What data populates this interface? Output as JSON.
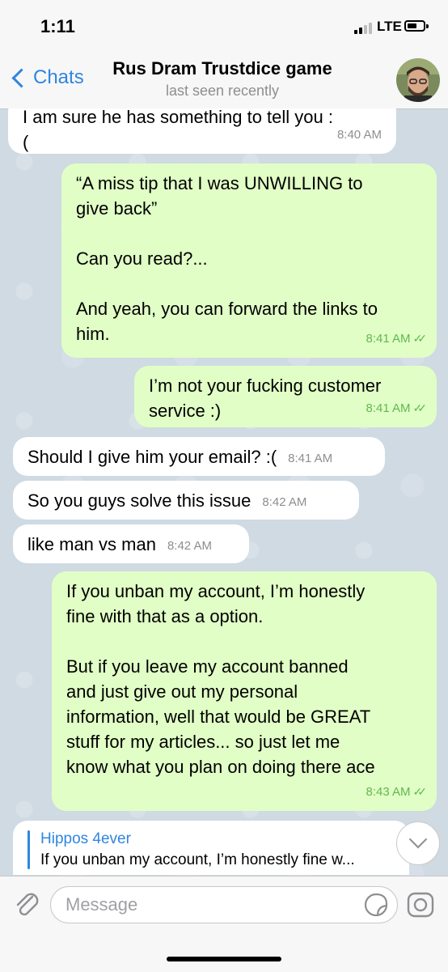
{
  "status_bar": {
    "time": "1:11",
    "network": "LTE"
  },
  "header": {
    "back_label": "Chats",
    "title": "Rus Dram Trustdice game",
    "subtitle": "last seen recently"
  },
  "messages": [
    {
      "direction": "in",
      "text": "I am sure he has something to tell you :\n(",
      "time": "8:40 AM"
    },
    {
      "direction": "out",
      "text": "“A miss tip that I was UNWILLING to\ngive back”\n\nCan you read?...\n\nAnd yeah, you can forward the links to\nhim.",
      "time": "8:41 AM"
    },
    {
      "direction": "out",
      "text": "I’m not your fucking customer\nservice :)",
      "time": "8:41 AM"
    },
    {
      "direction": "in",
      "text": "Should I give him your email? :(",
      "time": "8:41 AM"
    },
    {
      "direction": "in",
      "text": "So you guys solve this issue",
      "time": "8:42 AM"
    },
    {
      "direction": "in",
      "text": "like man vs man",
      "time": "8:42 AM"
    },
    {
      "direction": "out",
      "text": "If you unban my account, I’m honestly\nfine with that as a option.\n\nBut if you leave my account banned\nand just give out my personal\ninformation, well that would be GREAT\nstuff for my articles... so just let me\nknow what you plan on doing there ace",
      "time": "8:43 AM"
    }
  ],
  "reply_preview": {
    "name": "Hippos 4ever",
    "text": "If you unban my account, I’m honestly fine w..."
  },
  "input": {
    "placeholder": "Message"
  },
  "colors": {
    "accent": "#2f86e0",
    "outgoing_bubble": "#e1fec6",
    "incoming_bubble": "#ffffff",
    "read_check": "#5fb94e"
  },
  "icons": {
    "back": "chevron-left-icon",
    "attach": "paperclip-icon",
    "sticker": "sticker-icon",
    "camera": "camera-icon",
    "scroll_down": "chevron-down-icon",
    "read_receipt": "double-check-icon"
  }
}
